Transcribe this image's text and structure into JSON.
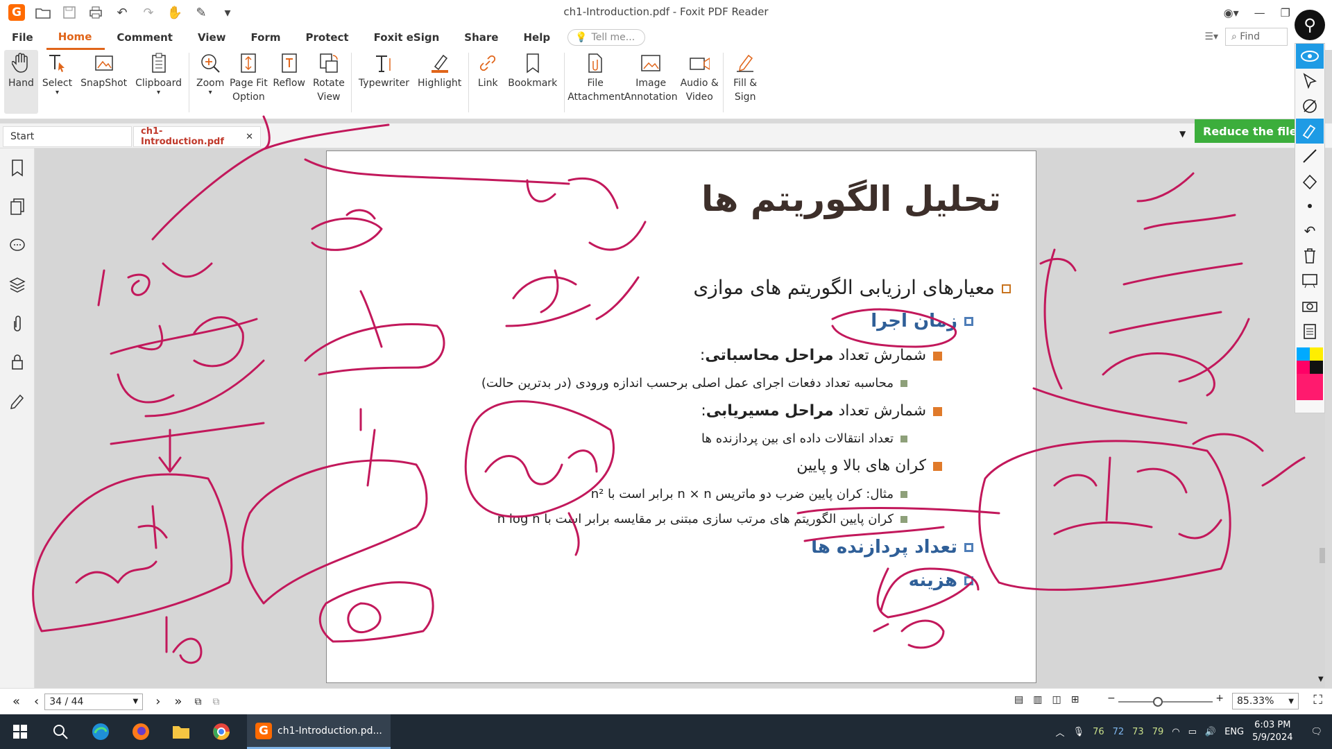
{
  "window": {
    "title": "ch1-Introduction.pdf - Foxit PDF Reader"
  },
  "menu": {
    "items": [
      "File",
      "Home",
      "Comment",
      "View",
      "Form",
      "Protect",
      "Foxit eSign",
      "Share",
      "Help"
    ],
    "active": "Home",
    "tellme_placeholder": "Tell me...",
    "find_placeholder": "Find"
  },
  "ribbon": {
    "tools": [
      {
        "label": "Hand",
        "icon": "hand-icon"
      },
      {
        "label": "Select",
        "icon": "select-text-icon"
      },
      {
        "label": "SnapShot",
        "icon": "snapshot-icon"
      },
      {
        "label": "Clipboard",
        "icon": "clipboard-icon"
      },
      {
        "label": "Zoom",
        "icon": "zoom-icon"
      },
      {
        "label": "Page Fit Option",
        "icon": "page-fit-icon"
      },
      {
        "label": "Reflow",
        "icon": "reflow-icon"
      },
      {
        "label": "Rotate View",
        "icon": "rotate-view-icon"
      },
      {
        "label": "Typewriter",
        "icon": "typewriter-icon"
      },
      {
        "label": "Highlight",
        "icon": "highlight-icon"
      },
      {
        "label": "Link",
        "icon": "link-icon"
      },
      {
        "label": "Bookmark",
        "icon": "bookmark-icon"
      },
      {
        "label": "File Attachment",
        "icon": "file-attachment-icon"
      },
      {
        "label": "Image Annotation",
        "icon": "image-annotation-icon"
      },
      {
        "label": "Audio & Video",
        "icon": "audio-video-icon"
      },
      {
        "label": "Fill & Sign",
        "icon": "fill-sign-icon"
      }
    ]
  },
  "tabs": {
    "start": "Start",
    "doc": "ch1-Introduction.pdf"
  },
  "promo": {
    "label": "Reduce the file size"
  },
  "slide": {
    "title": "تحلیل الگوریتم ها",
    "l1": "معیارهای ارزیابی الگوریتم های موازی",
    "l2": "زمان اجرا",
    "l3a": "شمارش تعداد ",
    "l3b": "مراحل محاسباتی",
    "l3c": ":",
    "l4": "محاسبه تعداد دفعات اجرای عمل اصلی برحسب اندازه ورودی (در بدترین حالت)",
    "l5a": "شمارش تعداد ",
    "l5b": "مراحل مسیریابی",
    "l5c": ":",
    "l6": "تعداد انتقالات داده ای بین پردازنده ها",
    "l7": "کران های بالا و پایین",
    "l8": "مثال: کران پایین ضرب دو ماتریس n × n برابر است با n²",
    "l9": "کران پایین الگوریتم های مرتب سازی مبتنی بر مقایسه برابر است با n log n",
    "l10": "تعداد پردازنده ها",
    "l11": "هزینه"
  },
  "ink": {
    "color": "#c2185b"
  },
  "status": {
    "page": "34 / 44",
    "zoom": "85.33%"
  },
  "taskbar": {
    "app_label": "ch1-Introduction.pd...",
    "numbers": [
      "76",
      "72",
      "73",
      "79"
    ],
    "lang": "ENG",
    "time": "6:03 PM",
    "date": "5/9/2024"
  }
}
